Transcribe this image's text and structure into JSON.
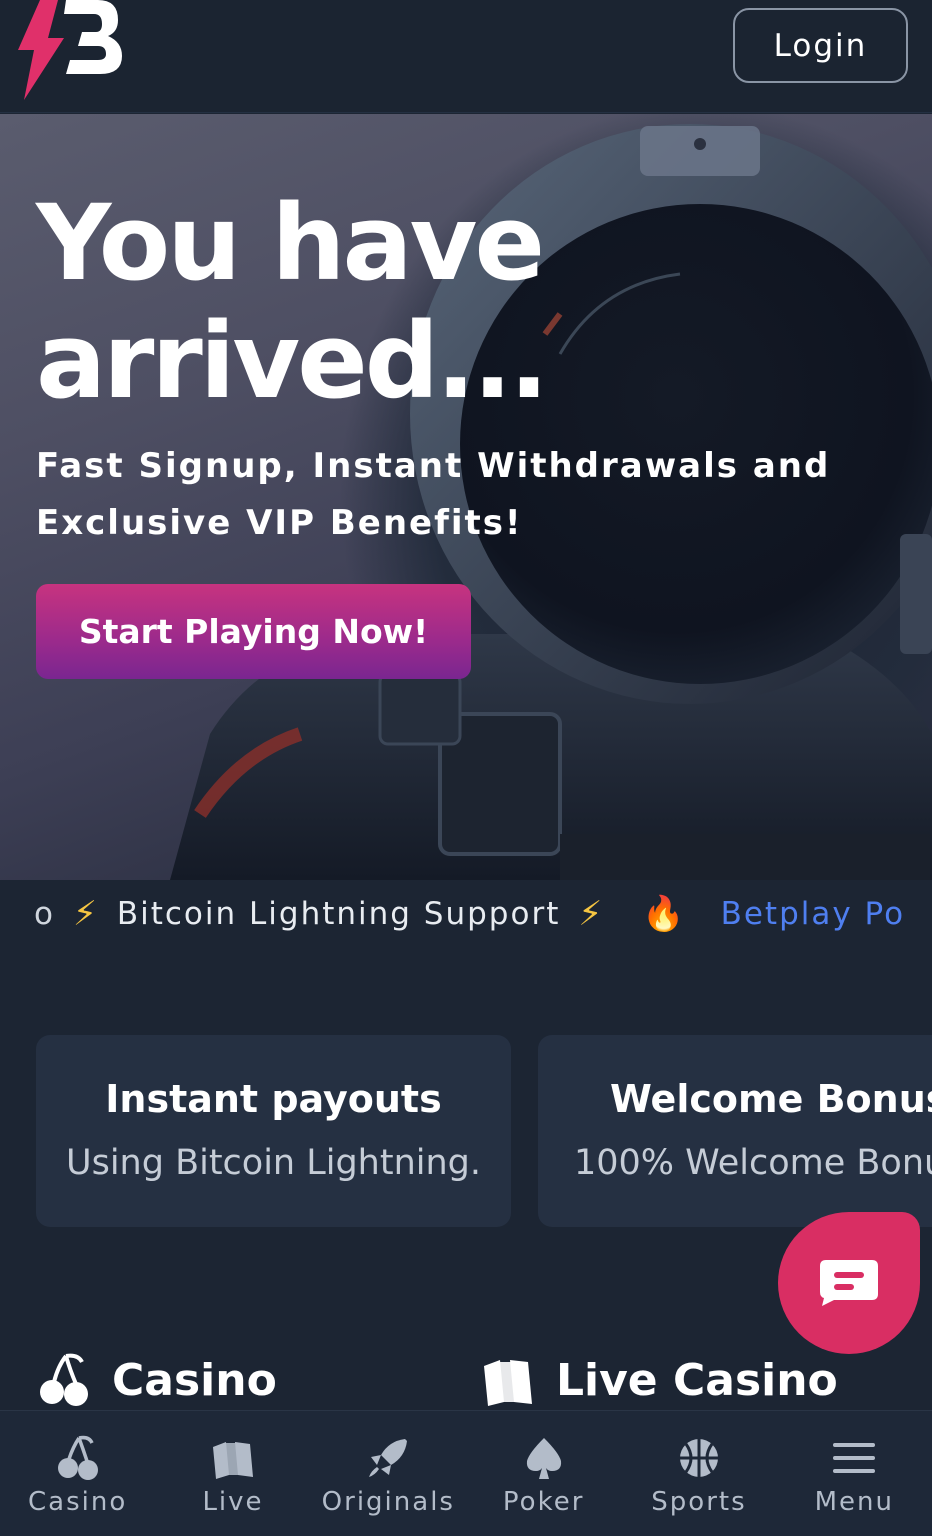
{
  "header": {
    "logo_icon": "betplay-lightning-b-logo",
    "login_label": "Login"
  },
  "hero": {
    "title": "You have arrived...",
    "subtitle": "Fast Signup, Instant Withdrawals and Exclusive VIP Benefits!",
    "cta_label": "Start Playing Now!",
    "background": "astronaut-helmet-illustration"
  },
  "ticker": {
    "fragment": "o",
    "item_text": "Bitcoin Lightning Support",
    "next_text": "Betplay Po",
    "bolt_icon": "lightning-emoji",
    "fire_icon": "fire-emoji",
    "link_color": "#4f7ff0"
  },
  "features": [
    {
      "title": "Instant payouts",
      "text": "Using Bitcoin Lightning."
    },
    {
      "title": "Welcome Bonus",
      "text": "100% Welcome Bonu"
    }
  ],
  "chat": {
    "icon": "chat-bubble-icon",
    "color": "#d92e63"
  },
  "sections": {
    "casino": {
      "label": "Casino",
      "icon": "cherries-icon"
    },
    "live": {
      "label": "Live Casino",
      "icon": "cards-icon"
    }
  },
  "bottom_nav": [
    {
      "label": "Casino",
      "icon": "cherries-icon"
    },
    {
      "label": "Live",
      "icon": "cards-icon"
    },
    {
      "label": "Originals",
      "icon": "rocket-icon"
    },
    {
      "label": "Poker",
      "icon": "spade-icon"
    },
    {
      "label": "Sports",
      "icon": "basketball-icon"
    },
    {
      "label": "Menu",
      "icon": "hamburger-icon"
    }
  ],
  "colors": {
    "background": "#1c2533",
    "card": "#253042",
    "cta_top": "#c7337f",
    "cta_bottom": "#7a2690",
    "brand_pink": "#d92e63"
  }
}
